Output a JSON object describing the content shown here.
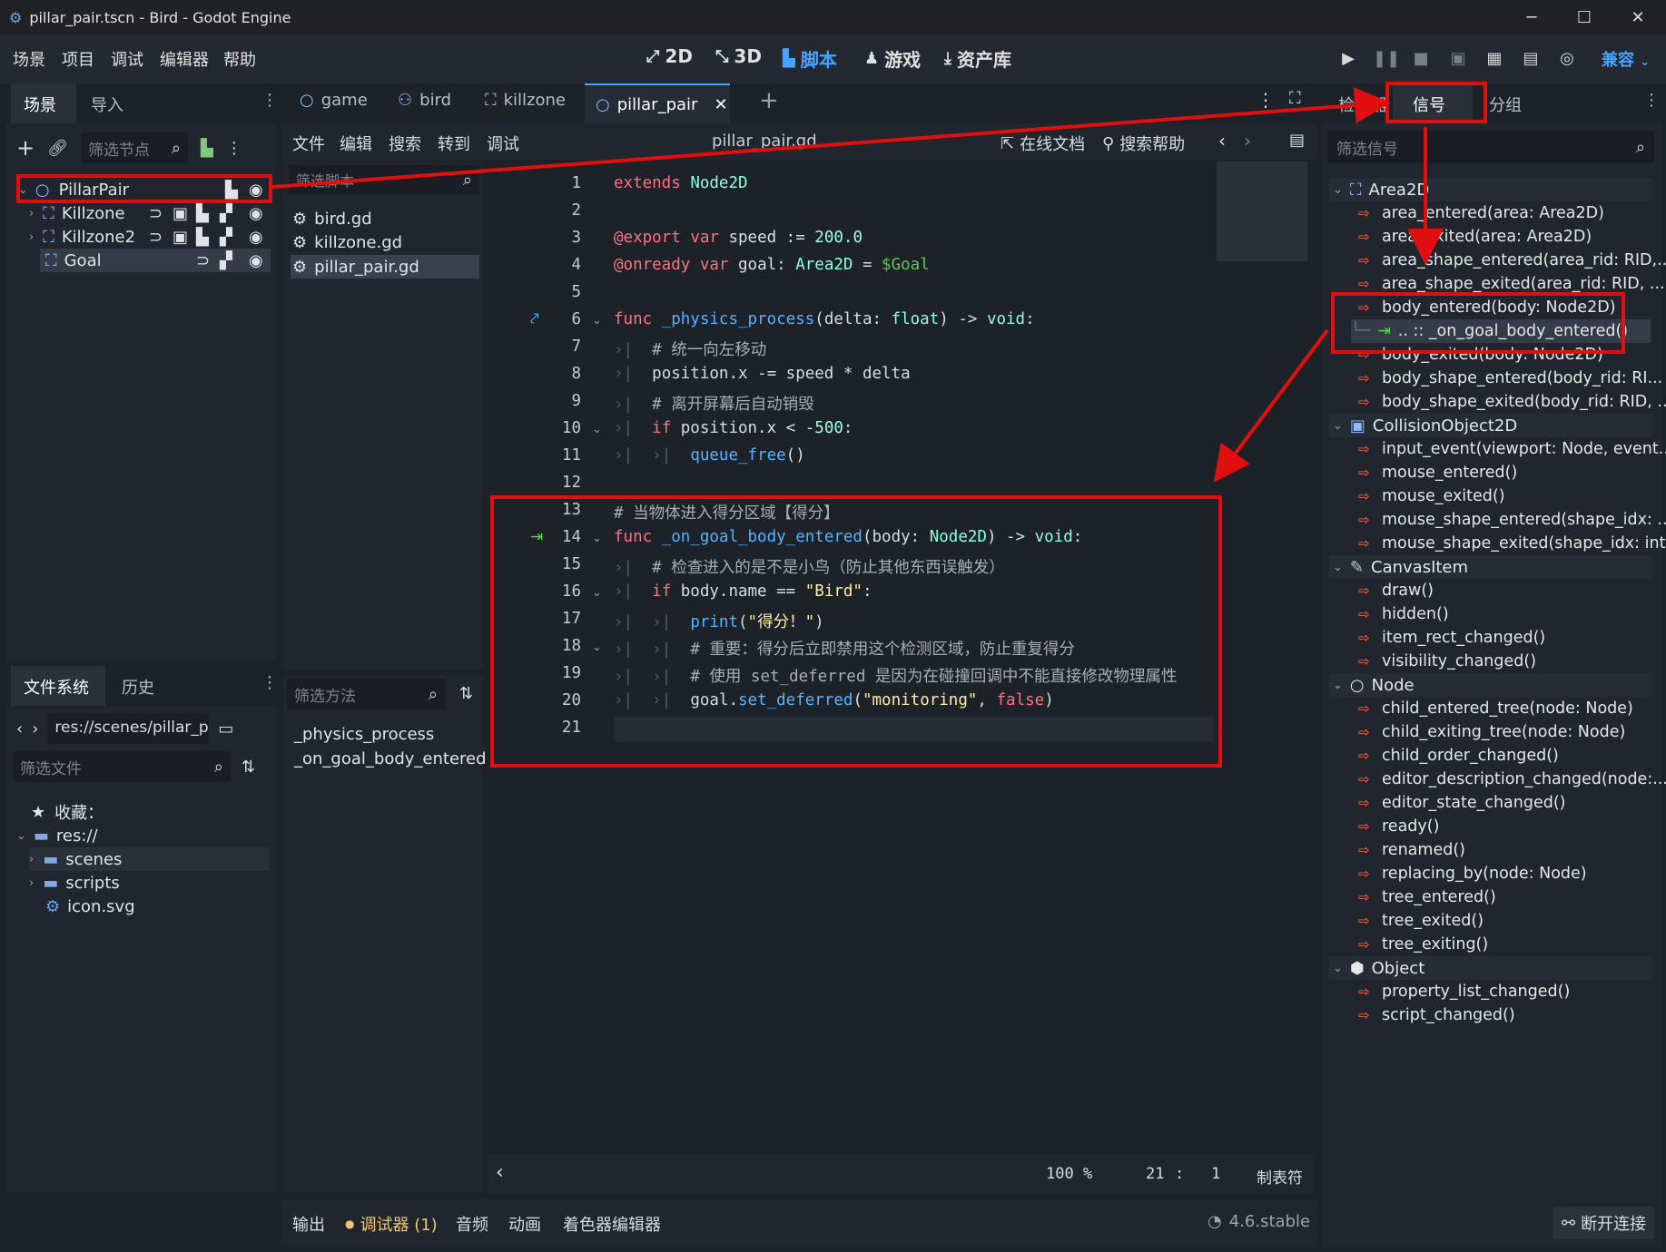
{
  "window": {
    "title": "pillar_pair.tscn - Bird - Godot Engine",
    "controls": [
      "─",
      "☐",
      "✕"
    ]
  },
  "menubar": {
    "menus": [
      "场景",
      "项目",
      "调试",
      "编辑器",
      "帮助"
    ],
    "main_buttons": [
      "2D",
      "3D",
      "脚本",
      "游戏",
      "资产库"
    ],
    "renderer": "兼容"
  },
  "scene_dock": {
    "tabs": [
      "场景",
      "导入"
    ],
    "filter_placeholder": "筛选节点",
    "nodes": [
      "PillarPair",
      "Killzone",
      "Killzone2",
      "Goal"
    ]
  },
  "filesystem_dock": {
    "tabs": [
      "文件系统",
      "历史"
    ],
    "path": "res://scenes/pillar_p",
    "filter_placeholder": "筛选文件",
    "favorites": "收藏：",
    "root": "res://",
    "items": [
      "scenes",
      "scripts",
      "icon.svg"
    ]
  },
  "editor_tabs": [
    "game",
    "bird",
    "killzone",
    "pillar_pair"
  ],
  "script_menu": {
    "menus": [
      "文件",
      "编辑",
      "搜索",
      "转到",
      "调试"
    ],
    "current_file": "pillar_pair.gd",
    "online_docs": "在线文档",
    "search_help": "搜索帮助"
  },
  "script_list": {
    "filter_placeholder": "筛选脚本",
    "files": [
      "bird.gd",
      "killzone.gd",
      "pillar_pair.gd"
    ],
    "methods_filter_placeholder": "筛选方法",
    "methods": [
      "_physics_process",
      "_on_goal_body_entered"
    ]
  },
  "code": {
    "line_numbers": [
      "1",
      "2",
      "3",
      "4",
      "5",
      "6",
      "7",
      "8",
      "9",
      "10",
      "11",
      "12",
      "13",
      "14",
      "15",
      "16",
      "17",
      "18",
      "19",
      "20",
      "21"
    ],
    "l1_a": "extends",
    "l1_b": "Node2D",
    "l3_a": "@export",
    "l3_b": "var",
    "l3_c": "speed := ",
    "l3_d": "200.0",
    "l4_a": "@onready",
    "l4_b": "var",
    "l4_c": "goal: ",
    "l4_d": "Area2D",
    "l4_e": " = ",
    "l4_f": "$Goal",
    "l6_a": "func",
    "l6_b": "_physics_process",
    "l6_c": "(delta: ",
    "l6_d": "float",
    "l6_e": ") -> ",
    "l6_f": "void",
    "l6_g": ":",
    "l7": "# 统一向左移动",
    "l8": "position.x -= speed * delta",
    "l9": "# 离开屏幕后自动销毁",
    "l10_a": "if",
    "l10_b": " position.x < ",
    "l10_c": "-500",
    "l10_d": ":",
    "l11_a": "queue_free",
    "l11_b": "()",
    "l13": "# 当物体进入得分区域【得分】",
    "l14_a": "func",
    "l14_b": "_on_goal_body_entered",
    "l14_c": "(body: ",
    "l14_d": "Node2D",
    "l14_e": ") -> ",
    "l14_f": "void",
    "l14_g": ":",
    "l15": "# 检查进入的是不是小鸟（防止其他东西误触发）",
    "l16_a": "if",
    "l16_b": " body.name == ",
    "l16_c": "\"Bird\"",
    "l16_d": ":",
    "l17_a": "print",
    "l17_b": "(",
    "l17_c": "\"得分！\"",
    "l17_d": ")",
    "l18": "# 重要：得分后立即禁用这个检测区域，防止重复得分",
    "l19": "# 使用 set_deferred 是因为在碰撞回调中不能直接修改物理属性",
    "l20_a": "goal.",
    "l20_b": "set_deferred",
    "l20_c": "(",
    "l20_d": "\"monitoring\"",
    "l20_e": ", ",
    "l20_f": "false",
    "l20_g": ")"
  },
  "status": {
    "zoom": "100 %",
    "line": "21",
    "sep": ":",
    "col": "1",
    "indent": "制表符"
  },
  "bottom_panel": {
    "tabs": [
      "输出",
      "调试器 (1)",
      "音频",
      "动画",
      "着色器编辑器"
    ],
    "version": "4.6.stable",
    "disconnect": "断开连接"
  },
  "right_dock": {
    "tabs": [
      "检查器",
      "信号",
      "分组"
    ],
    "filter_placeholder": "筛选信号",
    "classes": {
      "area2d": "Area2D",
      "collision": "CollisionObject2D",
      "canvas": "CanvasItem",
      "node": "Node",
      "object": "Object"
    },
    "area2d_signals": [
      "area_entered(area: Area2D)",
      "area_exited(area: Area2D)",
      "area_shape_entered(area_rid: RID,...",
      "area_shape_exited(area_rid: RID, ...",
      "body_entered(body: Node2D)"
    ],
    "connection": ".. :: _on_goal_body_entered()",
    "area2d_signals_2": [
      "body_exited(body: Node2D)",
      "body_shape_entered(body_rid: RI...",
      "body_shape_exited(body_rid: RID, ..."
    ],
    "collision_signals": [
      "input_event(viewport: Node, event...",
      "mouse_entered()",
      "mouse_exited()",
      "mouse_shape_entered(shape_idx: ...",
      "mouse_shape_exited(shape_idx: int)"
    ],
    "canvas_signals": [
      "draw()",
      "hidden()",
      "item_rect_changed()",
      "visibility_changed()"
    ],
    "node_signals": [
      "child_entered_tree(node: Node)",
      "child_exiting_tree(node: Node)",
      "child_order_changed()",
      "editor_description_changed(node:...",
      "editor_state_changed()",
      "ready()",
      "renamed()",
      "replacing_by(node: Node)",
      "tree_entered()",
      "tree_exited()",
      "tree_exiting()"
    ],
    "object_signals": [
      "property_list_changed()",
      "script_changed()"
    ]
  },
  "colors": {
    "accent": "#4aa3ff",
    "annotation_red": "#e10f0f",
    "signal_icon": "#ff6a55"
  }
}
